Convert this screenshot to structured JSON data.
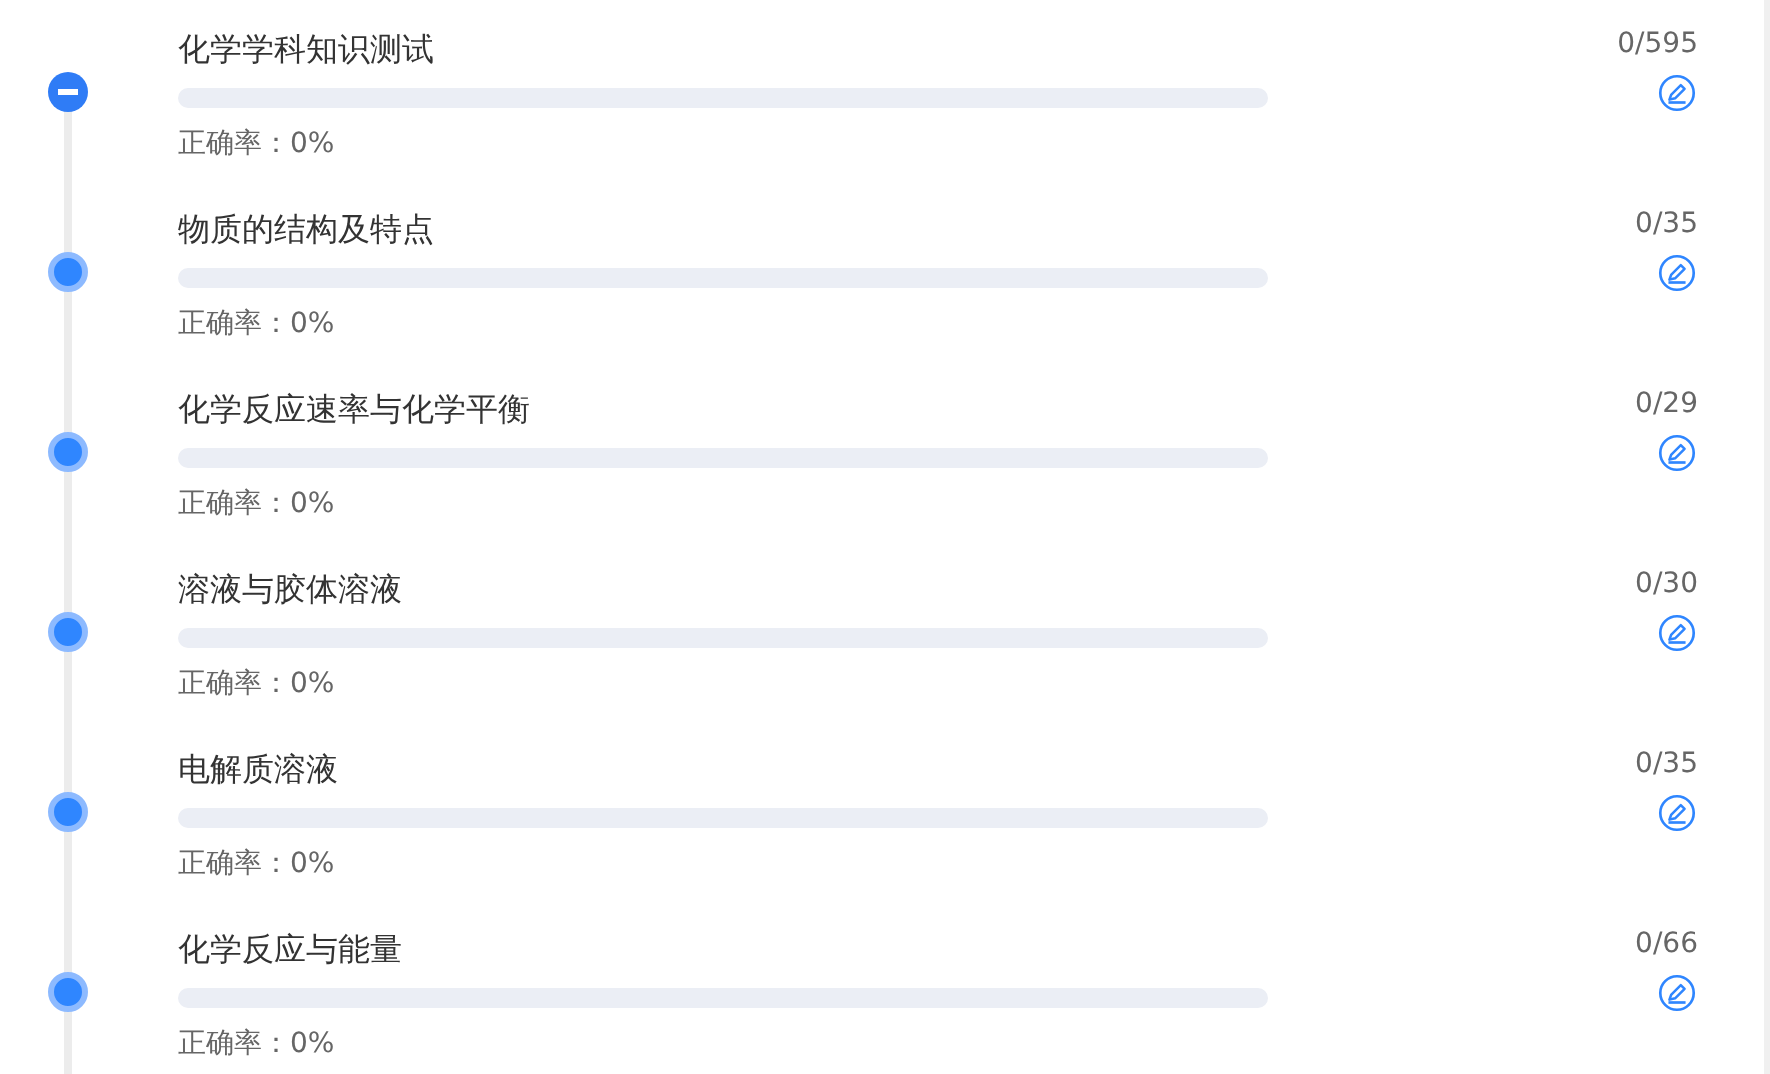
{
  "items": [
    {
      "kind": "group",
      "title": "化学学科知识测试",
      "level": 0,
      "accuracy": "正确率：0%",
      "count": "0/595"
    },
    {
      "kind": "leaf",
      "title": "物质的结构及特点",
      "level": 0,
      "accuracy": "正确率：0%",
      "count": "0/35"
    },
    {
      "kind": "leaf",
      "title": "化学反应速率与化学平衡",
      "level": 0,
      "accuracy": "正确率：0%",
      "count": "0/29"
    },
    {
      "kind": "leaf",
      "title": "溶液与胶体溶液",
      "level": 0,
      "accuracy": "正确率：0%",
      "count": "0/30"
    },
    {
      "kind": "leaf",
      "title": "电解质溶液",
      "level": 0,
      "accuracy": "正确率：0%",
      "count": "0/35"
    },
    {
      "kind": "leaf",
      "title": "化学反应与能量",
      "level": 0,
      "accuracy": "正确率：0%",
      "count": "0/66"
    }
  ]
}
